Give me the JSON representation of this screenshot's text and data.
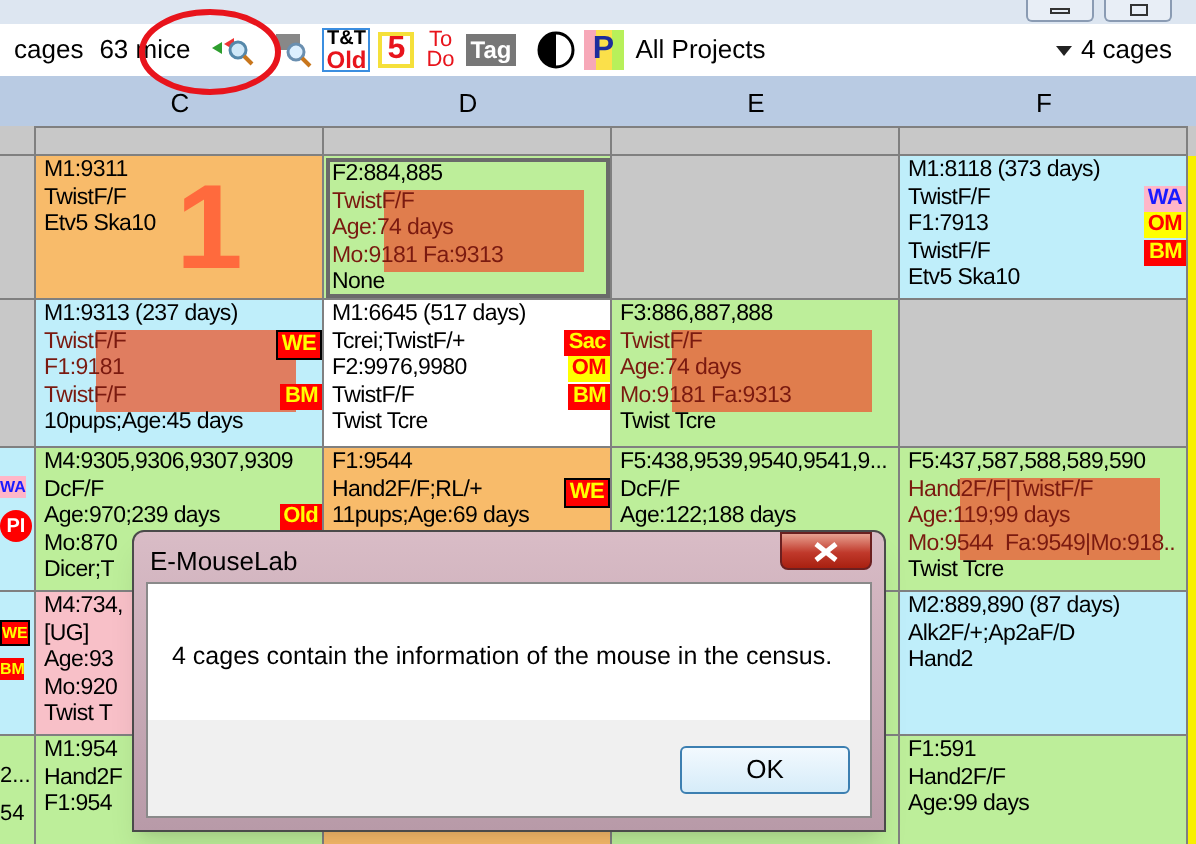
{
  "toolbar": {
    "cages_label": "cages",
    "mice_count": "63 mice",
    "tools": [
      {
        "kind": "magnifier-arrows"
      },
      {
        "kind": "magnifier-tag"
      },
      {
        "kind": "stack",
        "lines": [
          "T&T",
          "Old"
        ],
        "selected": true
      },
      {
        "kind": "number",
        "text": "5"
      },
      {
        "kind": "stack",
        "lines": [
          "To",
          "Do"
        ],
        "selected": false
      },
      {
        "kind": "tag",
        "text": "Tag"
      },
      {
        "kind": "contrast"
      },
      {
        "kind": "project",
        "text": "P"
      }
    ],
    "project_filter": "All Projects",
    "cage_count": "4 cages"
  },
  "columns": [
    "C",
    "D",
    "E",
    "F"
  ],
  "rows": [
    {
      "left": {
        "color": "#c8c8c8"
      },
      "cells": [
        {
          "color": "#f8bb6a",
          "lines": [
            {
              "text": "M1:9311"
            },
            {
              "text": "TwistF/F"
            },
            {
              "text": "Etv5 Ska10"
            }
          ],
          "big_number": "1"
        },
        {
          "color": "#bdee9a",
          "selected": true,
          "highlighted": true,
          "lines": [
            {
              "text": "F2:884,885"
            },
            {
              "text": "TwistF/F"
            },
            {
              "text": "Age:74 days"
            },
            {
              "text": "Mo:9181 Fa:9313"
            },
            {
              "text": "None"
            }
          ]
        },
        {
          "color": "#c8c8c8"
        },
        {
          "color": "#bfeefa",
          "lines": [
            {
              "text": "M1:8118 (373 days)"
            },
            {
              "text": "TwistF/F",
              "tag": {
                "text": "WA",
                "kind": "pink"
              }
            },
            {
              "text": "F1:7913",
              "tag": {
                "text": "OM",
                "kind": "yellow"
              }
            },
            {
              "text": "TwistF/F",
              "tag": {
                "text": "BM",
                "kind": "red"
              }
            },
            {
              "text": "Etv5 Ska10"
            }
          ]
        }
      ]
    },
    {
      "left": {
        "color": "#c8c8c8"
      },
      "cells": [
        {
          "color": "#bfeefa",
          "highlighted": true,
          "lines": [
            {
              "text": "M1:9313 (237 days)"
            },
            {
              "text": "TwistF/F",
              "tag": {
                "text": "WE",
                "kind": "red-boxed"
              }
            },
            {
              "text": "F1:9181"
            },
            {
              "text": "TwistF/F",
              "tag": {
                "text": "BM",
                "kind": "red"
              }
            },
            {
              "text": "10pups;Age:45 days"
            }
          ]
        },
        {
          "color": "#ffffff",
          "lines": [
            {
              "text": "M1:6645 (517 days)"
            },
            {
              "text": "Tcrei;TwistF/+",
              "tag": {
                "text": "Sac",
                "kind": "red"
              }
            },
            {
              "text": "F2:9976,9980",
              "tag": {
                "text": "OM",
                "kind": "yellow"
              }
            },
            {
              "text": "TwistF/F",
              "tag": {
                "text": "BM",
                "kind": "red"
              }
            },
            {
              "text": "Twist Tcre"
            }
          ]
        },
        {
          "color": "#bdee9a",
          "highlighted": true,
          "lines": [
            {
              "text": "F3:886,887,888"
            },
            {
              "text": "TwistF/F"
            },
            {
              "text": "Age:74 days"
            },
            {
              "text": "Mo:9181 Fa:9313"
            },
            {
              "text": "Twist Tcre"
            }
          ]
        },
        {
          "color": "#c8c8c8"
        }
      ]
    },
    {
      "left": {
        "color": "#bfeefa",
        "marks": [
          {
            "text": "WA",
            "kind": "pink"
          },
          {
            "text": "PI",
            "kind": "circle"
          }
        ]
      },
      "cells": [
        {
          "color": "#bdee9a",
          "lines": [
            {
              "text": "M4:9305,9306,9307,9309"
            },
            {
              "text": "DcF/F"
            },
            {
              "text": "Age:970;239 days",
              "tag": {
                "text": "Old",
                "kind": "red"
              }
            },
            {
              "text": "Mo:870"
            },
            {
              "text": "Dicer;T"
            }
          ]
        },
        {
          "color": "#f8bb6a",
          "lines": [
            {
              "text": "F1:9544"
            },
            {
              "text": "Hand2F/F;RL/+",
              "tag": {
                "text": "WE",
                "kind": "red-boxed"
              }
            },
            {
              "text": "11pups;Age:69 days"
            }
          ]
        },
        {
          "color": "#bdee9a",
          "lines": [
            {
              "text": "F5:438,9539,9540,9541,9..."
            },
            {
              "text": "DcF/F"
            },
            {
              "text": "Age:122;188 days"
            }
          ]
        },
        {
          "color": "#bdee9a",
          "highlighted": true,
          "lines": [
            {
              "text": "F5:437,587,588,589,590"
            },
            {
              "text": "Hand2F/F|TwistF/F"
            },
            {
              "text": "Age:119;99 days"
            },
            {
              "text": "Mo:9544  Fa:9549|Mo:918.."
            },
            {
              "text": "Twist Tcre"
            }
          ]
        }
      ]
    },
    {
      "left": {
        "color": "#bfeefa",
        "marks": [
          {
            "text": "WE",
            "kind": "red-boxed"
          },
          {
            "text": "BM",
            "kind": "red"
          }
        ]
      },
      "cells": [
        {
          "color": "#f8c0c8",
          "lines": [
            {
              "text": "M4:734,"
            },
            {
              "text": "[UG]"
            },
            {
              "text": "Age:93"
            },
            {
              "text": "Mo:920"
            },
            {
              "text": "Twist T"
            }
          ]
        },
        {},
        {
          "color": "#bdee9a"
        },
        {
          "color": "#bfeefa",
          "lines": [
            {
              "text": "M2:889,890 (87 days)"
            },
            {
              "text": "Alk2F/+;Ap2aF/D"
            },
            {
              "text": "Hand2"
            }
          ]
        }
      ]
    },
    {
      "left": {
        "color": "#bdee9a",
        "marks": [
          {
            "text": "2...",
            "kind": "plain"
          },
          {
            "text": "54",
            "kind": "plain"
          }
        ]
      },
      "cells": [
        {
          "color": "#bdee9a",
          "lines": [
            {
              "text": "M1:954"
            },
            {
              "text": "Hand2F"
            },
            {
              "text": "F1:954"
            }
          ]
        },
        {
          "color": "#f8bb6a"
        },
        {
          "color": "#bdee9a"
        },
        {
          "color": "#bdee9a",
          "lines": [
            {
              "text": "F1:591"
            },
            {
              "text": "Hand2F/F"
            },
            {
              "text": "Age:99 days"
            }
          ]
        }
      ]
    }
  ],
  "dialog": {
    "title": "E-MouseLab",
    "message": "4 cages contain the information of the mouse in the census.",
    "buttons": [
      "OK"
    ]
  }
}
